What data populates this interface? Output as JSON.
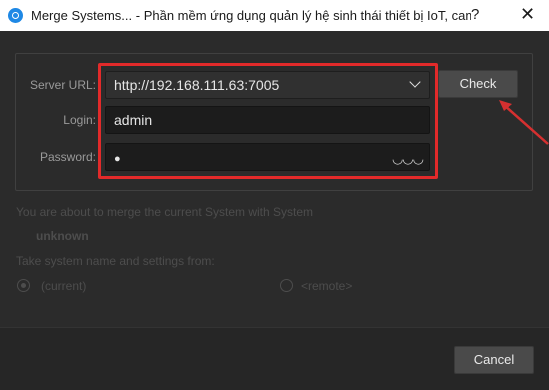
{
  "window": {
    "title": "Merge Systems... - Phần mềm ứng dụng quản lý hệ sinh thái thiết bị IoT, camer...",
    "help_glyph": "?",
    "close_glyph": "✕"
  },
  "form": {
    "server_url_label": "Server URL:",
    "server_url_value": "http://192.168.111.63:7005",
    "login_label": "Login:",
    "login_value": "admin",
    "password_label": "Password:",
    "password_value": "●",
    "eye_glyph": "◡◡◡",
    "check_label": "Check"
  },
  "merge": {
    "message": "You are about to merge the current System  with System",
    "system_name": "unknown",
    "take_label": "Take system name and settings from:",
    "option_current": "(current)",
    "option_remote": "<remote>",
    "selected": "current"
  },
  "footer": {
    "cancel_label": "Cancel"
  },
  "colors": {
    "highlight": "#e22a2a",
    "annotation_arrow": "#d63030"
  }
}
